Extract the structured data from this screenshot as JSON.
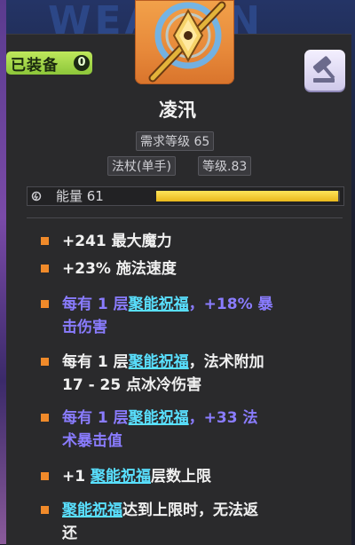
{
  "background": {
    "word": "WEAPON"
  },
  "header": {
    "equipped_label": "已装备",
    "equipped_count": "0"
  },
  "item": {
    "name": "凌汛",
    "required_level": "需求等级 65",
    "type": "法杖(单手)",
    "item_level": "等级.83",
    "energy_label": "能量 61",
    "energy_fraction": 0.99
  },
  "colors": {
    "accent_bullet": "#f08a2a",
    "keyword": "#59e0ff",
    "purple_stat": "#8a7cff",
    "equipped_green": "#a6d84a",
    "energy_yellow": "#f2c62a"
  },
  "stats": [
    {
      "color": "white",
      "text_a": "+241 最大魔力"
    },
    {
      "color": "white",
      "text_a": "+23% 施法速度"
    },
    {
      "color": "purple",
      "text_a": "每有 1 层",
      "keyword": "聚能祝福",
      "text_b": "，+18% 暴",
      "text_c": "击伤害"
    },
    {
      "color": "white",
      "text_a": "每有 1 层",
      "keyword": "聚能祝福",
      "text_b": "，法术附加",
      "text_c": "17 - 25 点冰冷伤害"
    },
    {
      "color": "purple",
      "text_a": "每有 1 层",
      "keyword": "聚能祝福",
      "text_b": "，+33 法",
      "text_c": "术暴击值"
    },
    {
      "color": "white",
      "text_a": "+1 ",
      "keyword": "聚能祝福",
      "text_b": "层数上限"
    },
    {
      "color": "white",
      "keyword": "聚能祝福",
      "text_b": "达到上限时，无法返",
      "text_c": "还"
    }
  ]
}
